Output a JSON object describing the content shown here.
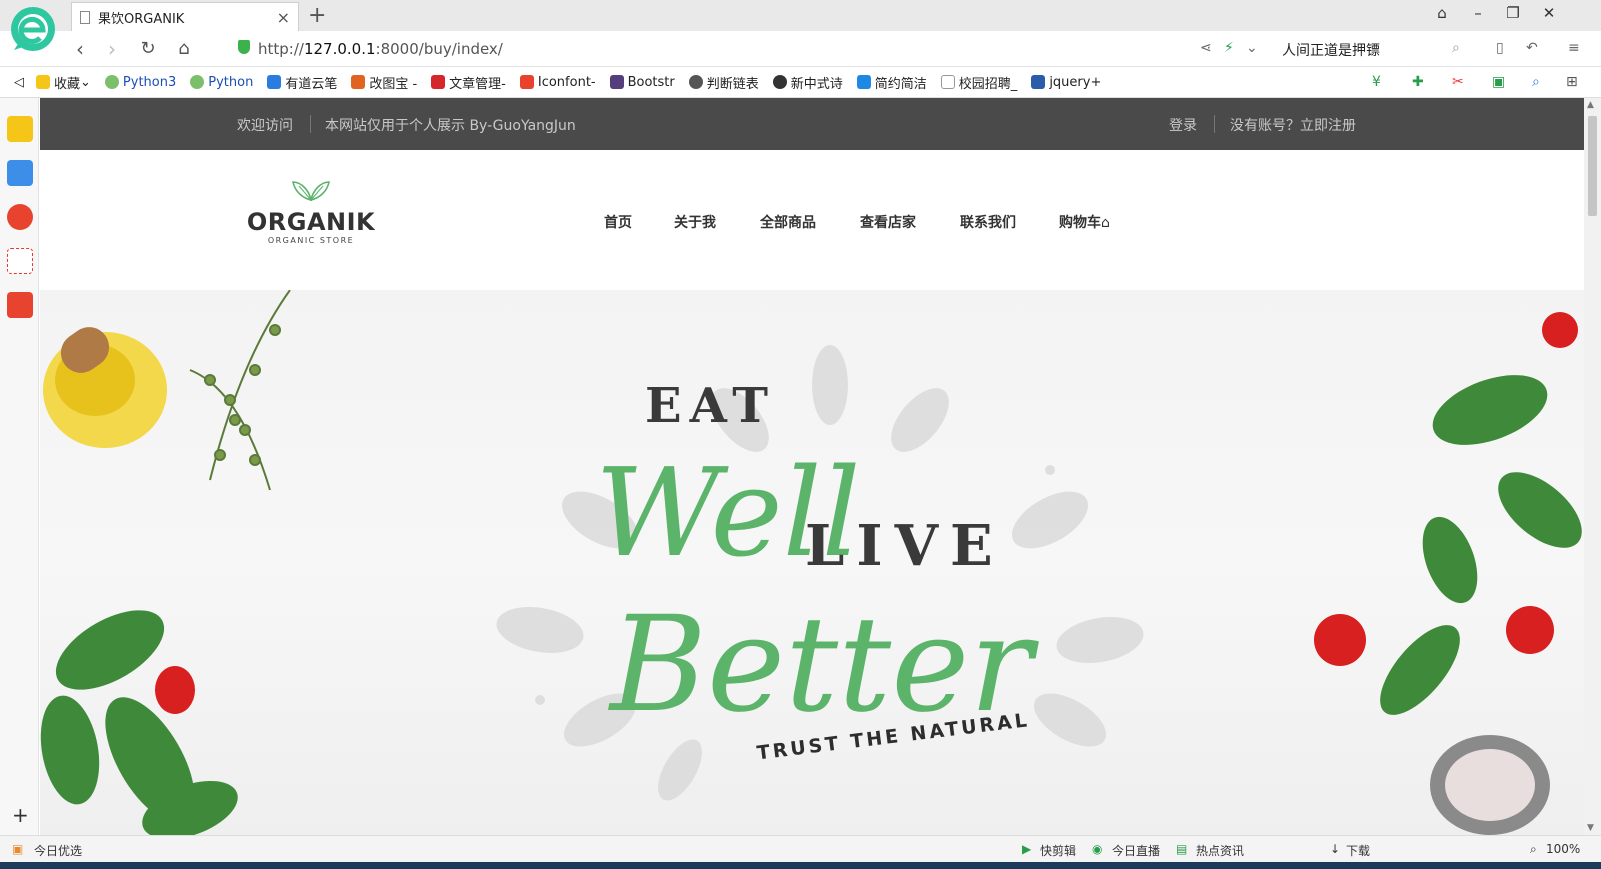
{
  "browser": {
    "tab_title": "果饮ORGANIK",
    "url_prefix": "http://",
    "url_host": "127.0.0.1",
    "url_path": ":8000/buy/index/",
    "search_text": "人间正道是押镖",
    "status_left": "今日优选",
    "status_items": [
      "快剪辑",
      "今日直播",
      "热点资讯",
      "下载"
    ],
    "zoom": "100%"
  },
  "bookmarks": [
    "收藏",
    "Python3",
    "Python",
    "有道云笔",
    "改图宝 -",
    "文章管理-",
    "Iconfont-",
    "Bootstr",
    "判断链表",
    "新中式诗",
    "简约简洁",
    "校园招聘_",
    "jquery+"
  ],
  "topbar": {
    "welcome": "欢迎访问",
    "notice": "本网站仅用于个人展示 By-GuoYangJun",
    "login": "登录",
    "register": "没有账号？立即注册"
  },
  "logo": {
    "name": "ORGANIK",
    "sub": "ORGANIC STORE"
  },
  "nav": [
    "首页",
    "关于我",
    "全部商品",
    "查看店家",
    "联系我们",
    "购物车"
  ],
  "hero": {
    "line1": "EAT",
    "line2": "Well",
    "line3": "LIVE",
    "line4": "Better",
    "line5": "TRUST THE NATURAL"
  },
  "colors": {
    "brand_green": "#5bb46a",
    "topbar": "#4a4a4a"
  }
}
